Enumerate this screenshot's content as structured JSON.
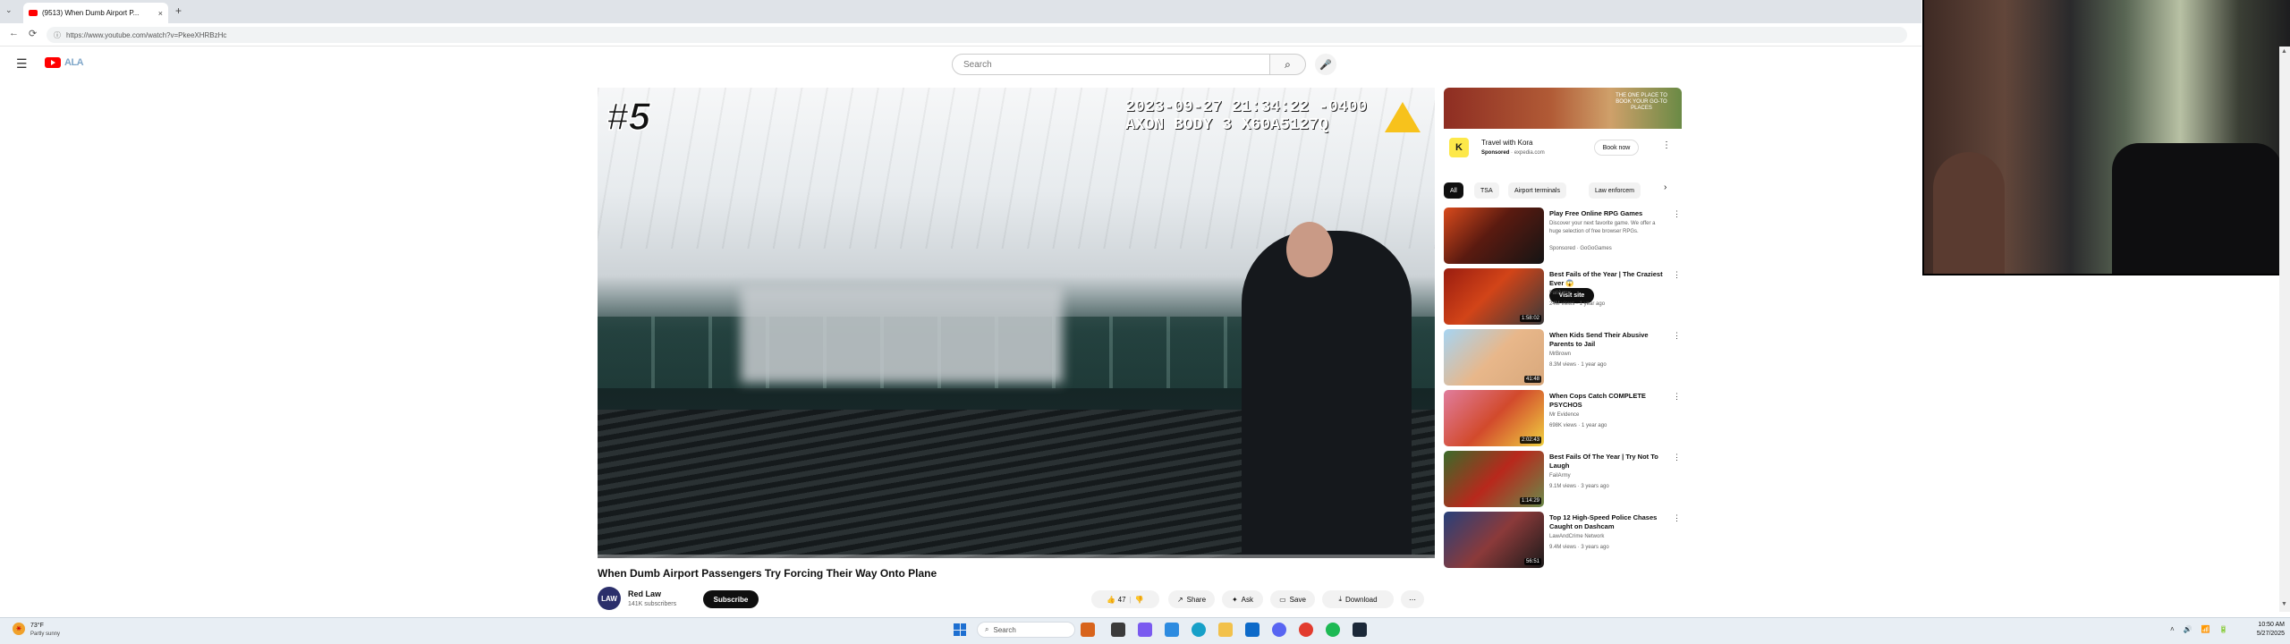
{
  "browser": {
    "tab_title": "(9513) When Dumb Airport P...",
    "tab_close": "×",
    "new_tab": "+",
    "url": "https://www.youtube.com/watch?v=PkeeXHRBzHc",
    "back": "←",
    "reload": "⟳",
    "tab_overflow": "⌄"
  },
  "youtube": {
    "menu_icon": "☰",
    "logo_word": "ALA",
    "search_placeholder": "Search",
    "search_icon": "⌕",
    "mic_icon": "🎤"
  },
  "video": {
    "overlay_rank": "#5",
    "timestamp": "2023-09-27 21:34:22 -0400\nAXON BODY 3 X60A5127Q",
    "progress": 0.0,
    "title": "When Dumb Airport Passengers Try Forcing Their Way Onto Plane",
    "channel_avatar_text": "LAW",
    "channel_name": "Red Law",
    "channel_subs": "141K subscribers",
    "subscribe": "Subscribe",
    "like_count": "47",
    "share": "Share",
    "ask": "Ask",
    "save": "Save",
    "download": "Download",
    "more": "⋯"
  },
  "ad": {
    "banner_text": "THE ONE PLACE TO BOOK YOUR GO-TO PLACES",
    "icon_letter": "K",
    "title": "Travel with Kora",
    "sponsored": "Sponsored",
    "domain": "expedia.com",
    "cta": "Book now",
    "kebab": "⋮"
  },
  "chips": [
    "All",
    "TSA",
    "Airport terminals",
    "Law enforcem"
  ],
  "chip_next": "›",
  "recommendations": [
    {
      "title": "Play Free Online RPG Games",
      "desc": "Discover your next favorite game. We offer a huge selection of free browser RPGs.",
      "channel": "Sponsored · GoGoGames",
      "meta": "",
      "duration": "",
      "cta": "Visit site",
      "thumb": "linear-gradient(135deg, #d94a1c 0%, #5a1a10 45%, #141414 100%)"
    },
    {
      "title": "Best Fails of the Year | The Craziest Ever 😱",
      "desc": "",
      "channel": "FailArmy",
      "meta": "24M views · 1 year ago",
      "duration": "1:58:02",
      "cta": "",
      "thumb": "linear-gradient(135deg, #9a1d10 0%, #d24418 45%, #3a3a3a 100%)"
    },
    {
      "title": "When Kids Send Their Abusive Parents to Jail",
      "desc": "",
      "channel": "MrBrown",
      "meta": "8.3M views · 1 year ago",
      "duration": "41:48",
      "cta": "",
      "thumb": "linear-gradient(135deg, #a6d4f2 0%, #e8b78a 50%, #d8a87c 100%)"
    },
    {
      "title": "When Cops Catch COMPLETE PSYCHOS",
      "desc": "",
      "channel": "Mr Evidence",
      "meta": "698K views · 1 year ago",
      "duration": "2:02:43",
      "cta": "",
      "thumb": "linear-gradient(135deg, #e07d9d 0%, #d24a2c 50%, #f0d040 100%)"
    },
    {
      "title": "Best Fails Of The Year | Try Not To Laugh",
      "desc": "",
      "channel": "FailArmy",
      "meta": "9.1M views · 3 years ago",
      "duration": "1:14:29",
      "cta": "",
      "thumb": "linear-gradient(135deg, #3a6b2a 0%, #b8281c 50%, #6a8a4a 100%)"
    },
    {
      "title": "Top 12 High-Speed Police Chases Caught on Dashcam",
      "desc": "",
      "channel": "LawAndCrime Network",
      "meta": "9.4M views · 3 years ago",
      "duration": "56:51",
      "cta": "",
      "thumb": "linear-gradient(135deg, #27407a 0%, #8b3a3a 50%, #1a1a1a 100%)"
    }
  ],
  "taskbar": {
    "weather_temp": "73°F",
    "weather_desc": "Partly sunny",
    "search": "Search",
    "time": "10:50 AM",
    "date": "5/27/2025",
    "tray": [
      "˄",
      "🔊",
      "📶",
      "🔋"
    ]
  },
  "colors": {
    "youtube_red": "#ff0000",
    "accent_dark": "#0f0f0f"
  }
}
